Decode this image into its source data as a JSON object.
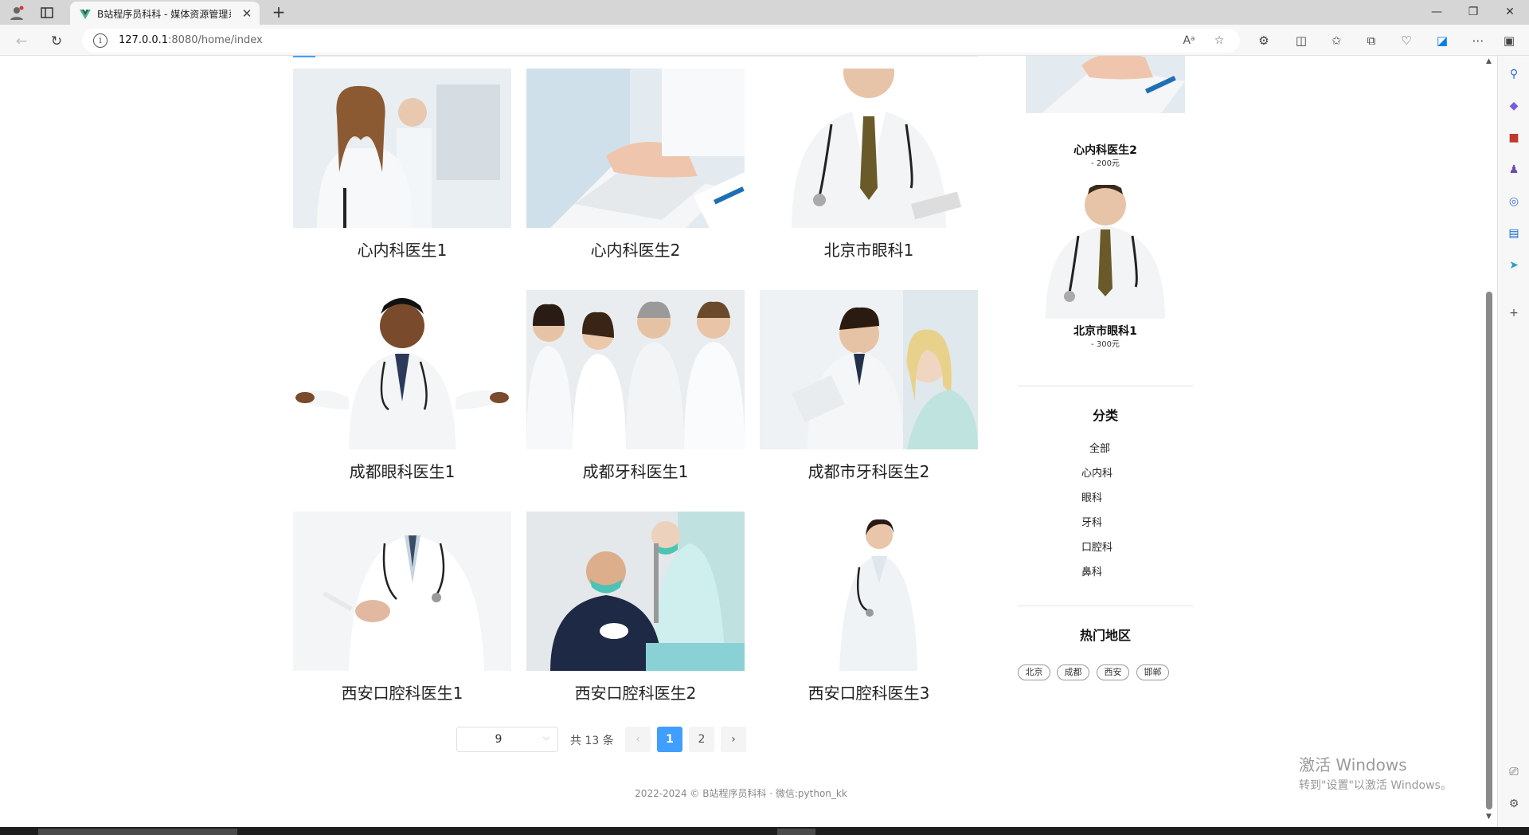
{
  "browser": {
    "tab_title": "B站程序员科科 - 媒体资源管理系",
    "url_host": "127.0.0.1",
    "url_path": ":8080/home/index",
    "new_tab": "+",
    "close": "✕"
  },
  "products": [
    {
      "name": "心内科医生1"
    },
    {
      "name": "心内科医生2"
    },
    {
      "name": "北京市眼科1"
    },
    {
      "name": "成都眼科医生1"
    },
    {
      "name": "成都牙科医生1"
    },
    {
      "name": "成都市牙科医生2"
    },
    {
      "name": "西安口腔科医生1"
    },
    {
      "name": "西安口腔科医生2"
    },
    {
      "name": "西安口腔科医生3"
    }
  ],
  "pagination": {
    "page_size": "9",
    "total": "共 13 条",
    "prev": "‹",
    "pages": [
      "1",
      "2"
    ],
    "next": "›"
  },
  "sidebar": {
    "recommend": [
      {
        "name": "心内科医生2",
        "price": "- 200元"
      },
      {
        "name": "北京市眼科1",
        "price": "- 300元"
      }
    ],
    "category_title": "分类",
    "categories": [
      "全部",
      "心内科",
      "眼科",
      "牙科",
      "口腔科",
      "鼻科"
    ],
    "region_title": "热门地区",
    "regions": [
      "北京",
      "成都",
      "西安",
      "邯郸"
    ]
  },
  "footer": "2022-2024 © B站程序员科科 · 微信:python_kk",
  "watermark": {
    "line1": "激活 Windows",
    "line2": "转到\"设置\"以激活 Windows。"
  },
  "colors": {
    "accent": "#409eff"
  }
}
